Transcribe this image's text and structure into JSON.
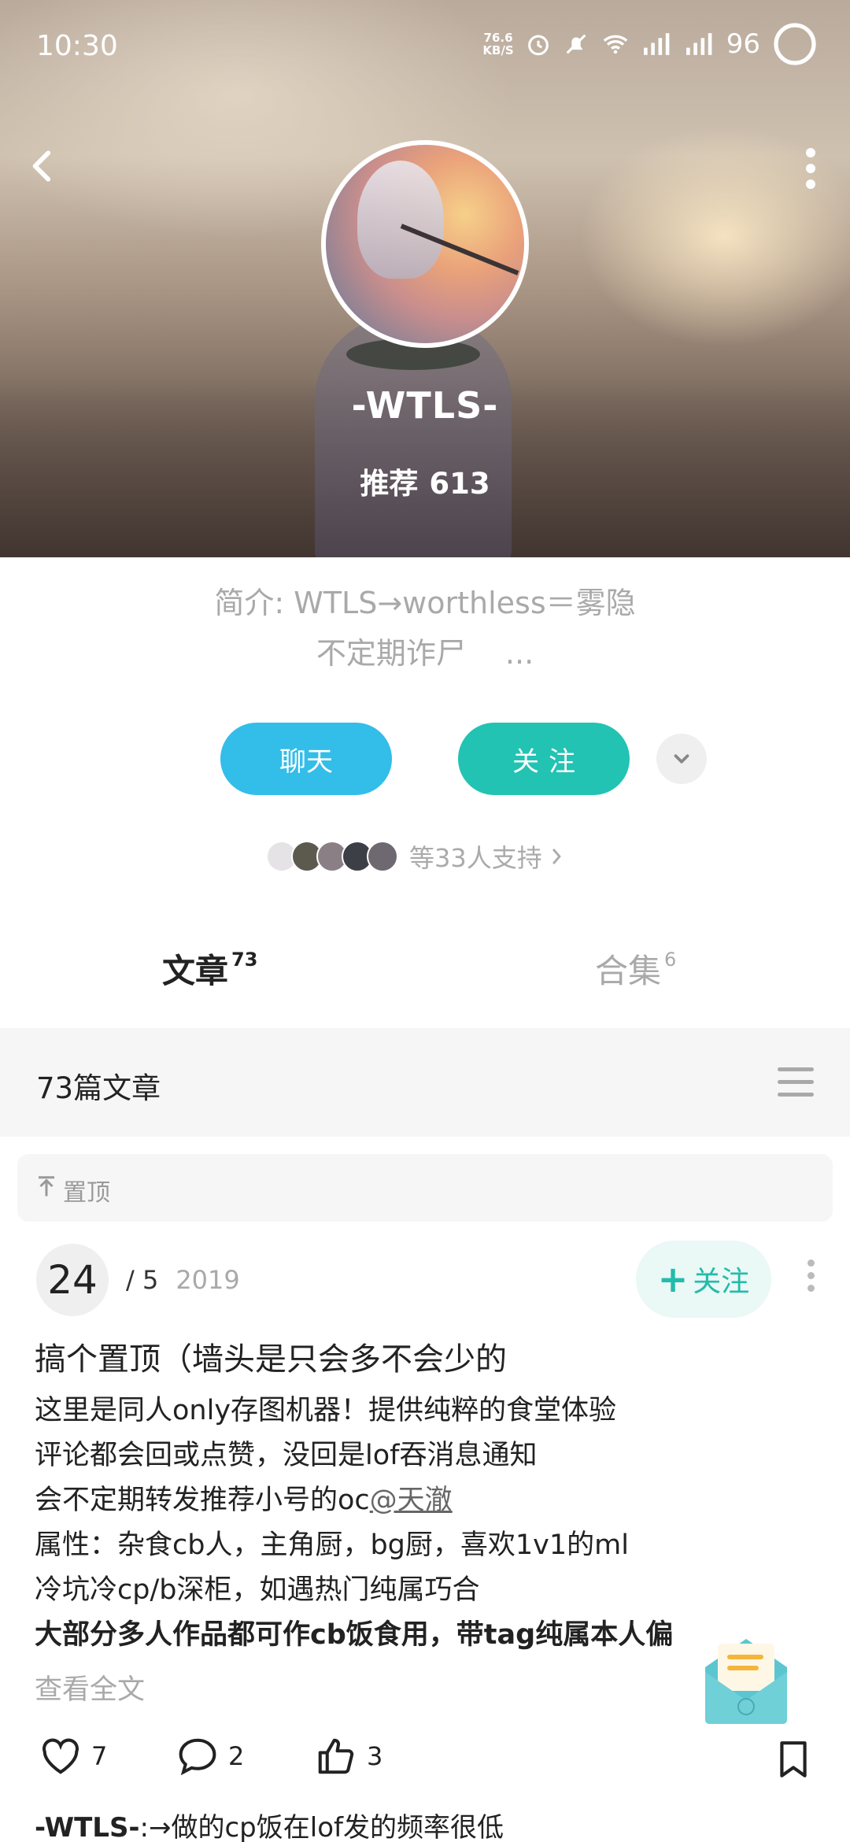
{
  "status_bar": {
    "time": "10:30",
    "net_speed_value": "76.6",
    "net_speed_unit": "KB/S",
    "battery": "96",
    "icons": [
      "alarm-icon",
      "mute-icon",
      "wifi-icon",
      "5g-signal-icon",
      "4g-signal-icon",
      "battery-ring-icon"
    ]
  },
  "header": {
    "back_icon": "back-chevron-icon",
    "more_icon": "more-vertical-icon"
  },
  "profile": {
    "username": "-WTLS-",
    "recommend_label": "推荐",
    "recommend_count": "613",
    "bio_line1": "简介: WTLS→worthless＝雾隐",
    "bio_line2": "不定期诈尸　 ..."
  },
  "actions": {
    "chat_label": "聊天",
    "follow_label": "关注",
    "expand_icon": "chevron-down-icon"
  },
  "supporters": {
    "text": "等33人支持"
  },
  "tabs": [
    {
      "label": "文章",
      "count": "73",
      "active": true
    },
    {
      "label": "合集",
      "count": "6",
      "active": false
    }
  ],
  "list": {
    "title": "73篇文章",
    "pinned_label": "置顶"
  },
  "post": {
    "day": "24",
    "month": "/ 5",
    "year": "2019",
    "follow_label": "关注",
    "title": "搞个置顶（墙头是只会多不会少的",
    "lines": [
      "这里是同人only存图机器！提供纯粹的食堂体验",
      "评论都会回或点赞，没回是lof吞消息通知",
      "会不定期转发推荐小号的oc",
      "属性：杂食cb人，主角厨，bg厨，喜欢1v1的ml",
      "冷坑冷cp/b深柜，如遇热门纯属巧合",
      "大部分多人作品都可作cb饭食用，带tag纯属本人偏"
    ],
    "mention": "@天澈",
    "read_more": "查看全文",
    "likes": "7",
    "comments": "2",
    "thumbs": "3"
  },
  "next_post": {
    "author": "-WTLS-",
    "text": ":→做的cp饭在lof发的频率很低"
  },
  "colors": {
    "chat": "#33bde9",
    "follow": "#22c3b2",
    "follow_soft_bg": "#eaf8f6",
    "muted": "#a9a9a9"
  }
}
